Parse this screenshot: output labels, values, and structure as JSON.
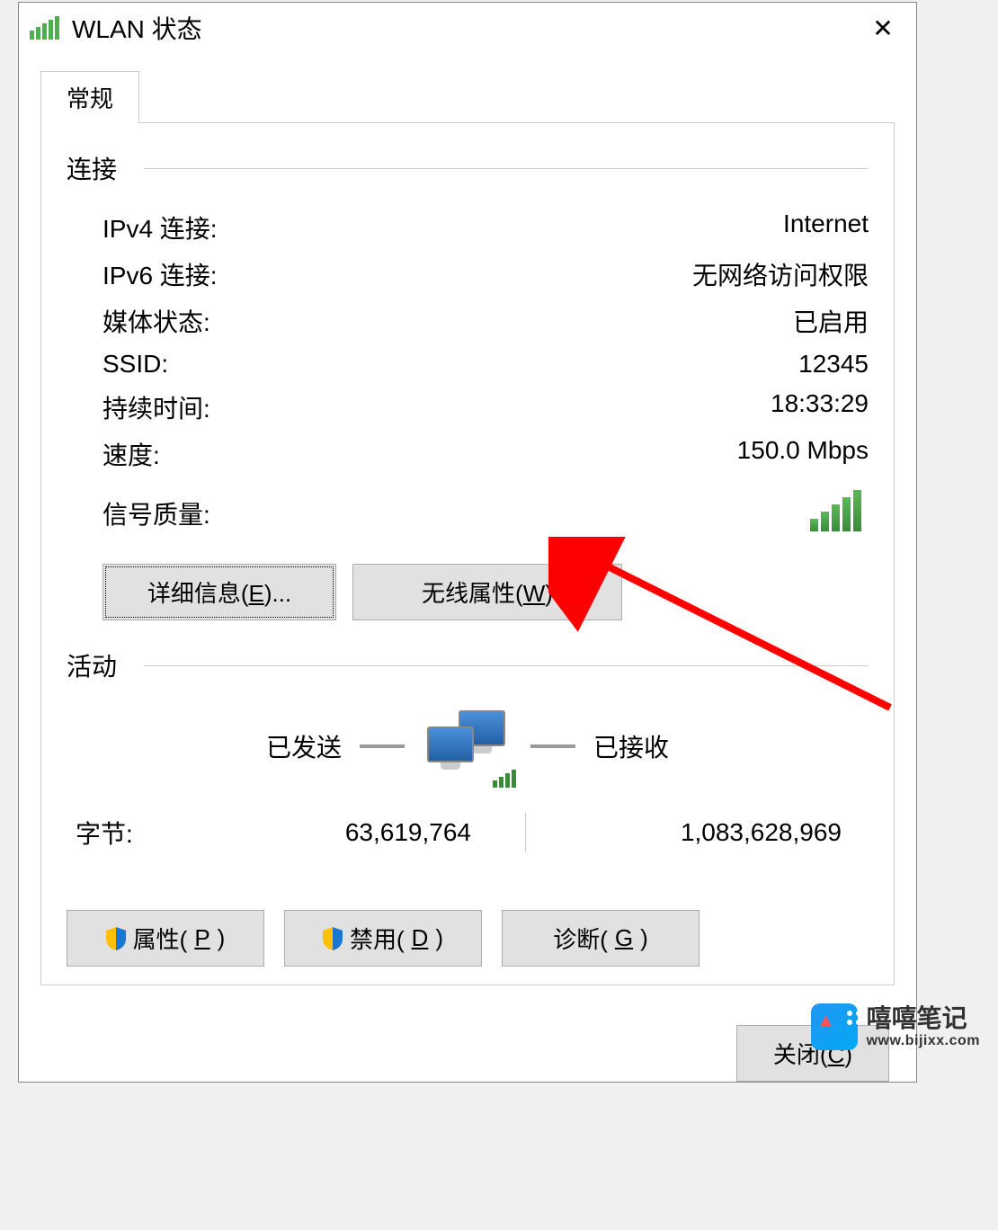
{
  "window": {
    "title": "WLAN 状态"
  },
  "tab": {
    "label": "常规"
  },
  "connection": {
    "section_label": "连接",
    "rows": {
      "ipv4": {
        "label": "IPv4 连接:",
        "value": "Internet"
      },
      "ipv6": {
        "label": "IPv6 连接:",
        "value": "无网络访问权限"
      },
      "media": {
        "label": "媒体状态:",
        "value": "已启用"
      },
      "ssid": {
        "label": "SSID:",
        "value": "12345"
      },
      "duration": {
        "label": "持续时间:",
        "value": "18:33:29"
      },
      "speed": {
        "label": "速度:",
        "value": "150.0 Mbps"
      },
      "signal": {
        "label": "信号质量:"
      }
    }
  },
  "buttons": {
    "details_prefix": "详细信息(",
    "details_accel": "E",
    "details_suffix": ")...",
    "wireless_prefix": "无线属性(",
    "wireless_accel": "W",
    "wireless_suffix": ")"
  },
  "activity": {
    "section_label": "活动",
    "sent_label": "已发送",
    "received_label": "已接收",
    "bytes_label": "字节:",
    "sent_value": "63,619,764",
    "received_value": "1,083,628,969"
  },
  "bottom_buttons": {
    "properties_prefix": "属性(",
    "properties_accel": "P",
    "properties_suffix": ")",
    "disable_prefix": "禁用(",
    "disable_accel": "D",
    "disable_suffix": ")",
    "diagnose_prefix": "诊断(",
    "diagnose_accel": "G",
    "diagnose_suffix": ")"
  },
  "footer": {
    "close_prefix": "关闭(",
    "close_accel": "C",
    "close_suffix": ")"
  },
  "watermark": {
    "name": "嘻嘻笔记",
    "url": "www.bijixx.com"
  }
}
